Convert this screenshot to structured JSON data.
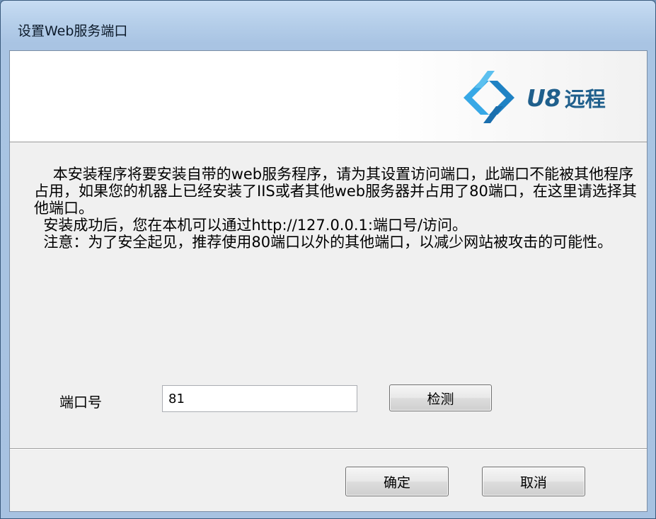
{
  "window": {
    "title": "设置Web服务端口"
  },
  "banner": {
    "logo_u8": "U8",
    "logo_cn": "远程"
  },
  "description": {
    "paragraph1": "    本安装程序将要安装自带的web服务程序，请为其设置访问端口，此端口不能被其他程序占用，如果您的机器上已经安装了IIS或者其他web服务器并占用了80端口，在这里请选择其他端口。",
    "paragraph2": "  安装成功后，您在本机可以通过http://127.0.0.1:端口号/访问。",
    "paragraph3": "  注意：为了安全起见，推荐使用80端口以外的其他端口，以减少网站被攻击的可能性。"
  },
  "port": {
    "label": "端口号",
    "value": "81"
  },
  "buttons": {
    "check": "检测",
    "ok": "确定",
    "cancel": "取消"
  },
  "colors": {
    "logo_blue": "#1f5f8c",
    "logo_light_blue": "#37a8e6"
  },
  "icons": {
    "logo": "u8-remote-logo-icon"
  }
}
